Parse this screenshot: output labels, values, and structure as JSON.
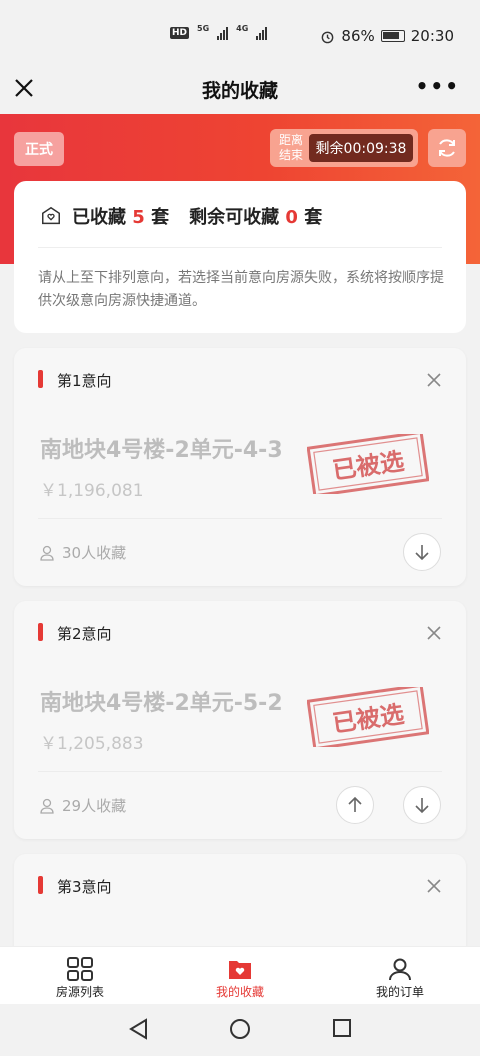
{
  "status_bar": {
    "hd": "HD",
    "net1": "5G",
    "net2": "4G",
    "battery": "86%",
    "time": "20:30"
  },
  "nav": {
    "title": "我的收藏",
    "more": "•••"
  },
  "banner": {
    "mode_tag": "正式",
    "countdown_label": "距离结束",
    "countdown_value": "剩余00:09:38"
  },
  "summary": {
    "collected_prefix": "已收藏",
    "collected_count": "5",
    "unit": "套",
    "remaining_prefix": "剩余可收藏",
    "remaining_count": "0",
    "note": "请从上至下排列意向，若选择当前意向房源失败，系统将按顺序提供次级意向房源快捷通道。"
  },
  "cards": [
    {
      "title": "第1意向",
      "name": "南地块4号楼-2单元-4-3",
      "price": "￥1,196,081",
      "favorites": "30人收藏",
      "stamp": "已被选"
    },
    {
      "title": "第2意向",
      "name": "南地块4号楼-2单元-5-2",
      "price": "￥1,205,883",
      "favorites": "29人收藏",
      "stamp": "已被选"
    },
    {
      "title": "第3意向"
    }
  ],
  "tabs": [
    {
      "label": "房源列表",
      "icon": "grid-icon"
    },
    {
      "label": "我的收藏",
      "icon": "folder-heart-icon"
    },
    {
      "label": "我的订单",
      "icon": "user-icon"
    }
  ],
  "colors": {
    "accent": "#e53935",
    "banner_start": "#e8363c",
    "banner_end": "#f46438",
    "countdown_bg": "#722a1f"
  }
}
